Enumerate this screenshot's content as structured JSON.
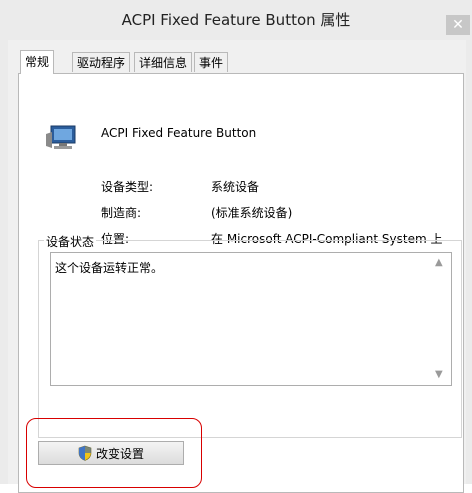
{
  "window": {
    "title": "ACPI Fixed Feature Button 属性",
    "close_glyph": "✕"
  },
  "tabs": [
    {
      "label": "常规",
      "active": true
    },
    {
      "label": "驱动程序",
      "active": false
    },
    {
      "label": "详细信息",
      "active": false
    },
    {
      "label": "事件",
      "active": false
    }
  ],
  "general": {
    "device_icon": "computer-monitor-icon",
    "device_name": "ACPI Fixed Feature Button",
    "properties": [
      {
        "label": "设备类型:",
        "value": "系统设备"
      },
      {
        "label": "制造商:",
        "value": "(标准系统设备)"
      },
      {
        "label": "位置:",
        "value": "在 Microsoft ACPI-Compliant System 上"
      }
    ],
    "status_group_title": "设备状态",
    "status_text": "这个设备运转正常。",
    "scroll_up_glyph": "▲",
    "scroll_down_glyph": "▼",
    "change_settings_label": "改变设置",
    "change_settings_icon": "uac-shield-icon"
  },
  "colors": {
    "highlight": "#d80000"
  }
}
